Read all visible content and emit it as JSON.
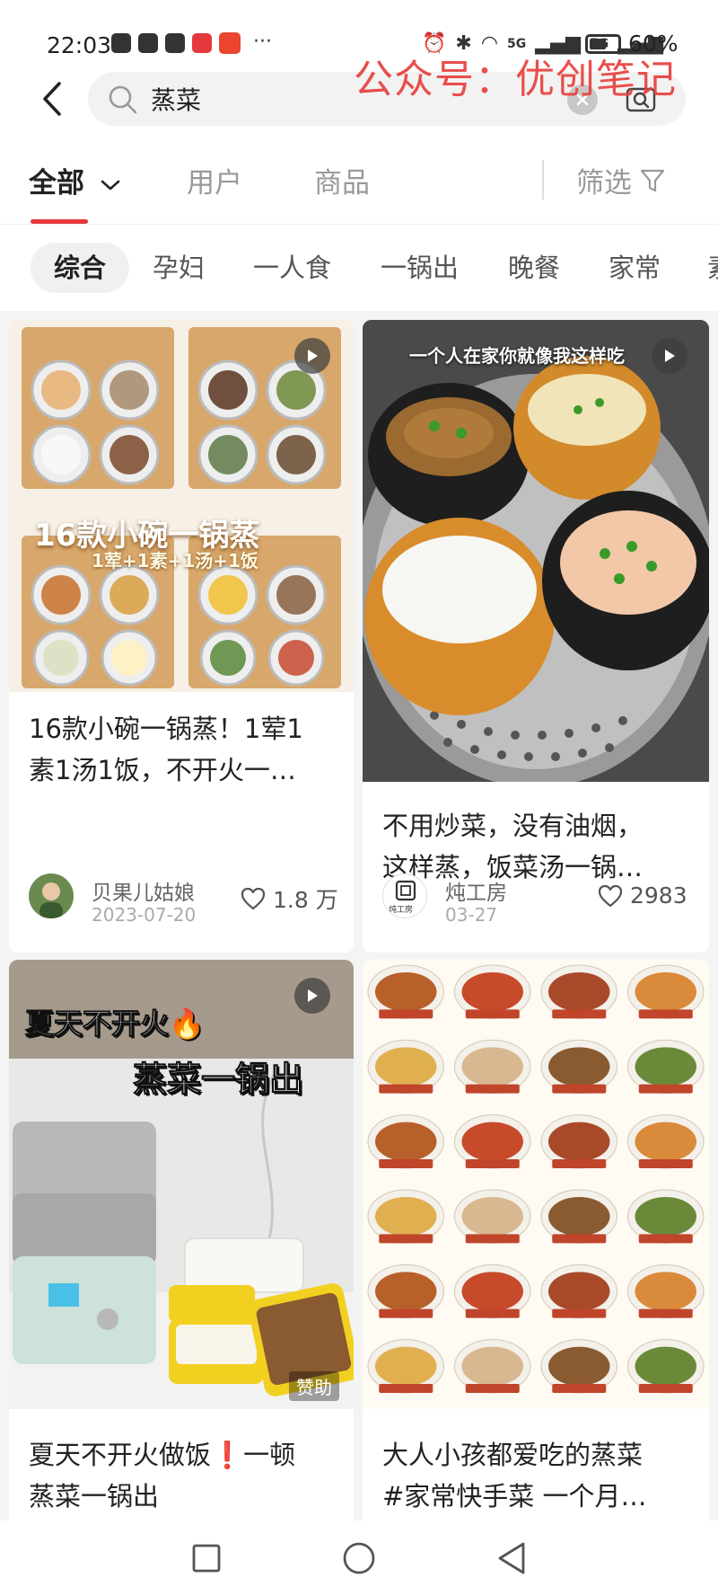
{
  "status_bar": {
    "time": "22:03",
    "battery": "60%",
    "signal_label_1": "5G",
    "signal_label_2": "5G"
  },
  "watermark": "公众号：优创笔记",
  "search": {
    "query": "蒸菜"
  },
  "tabs": [
    {
      "label": "全部"
    },
    {
      "label": "用户"
    },
    {
      "label": "商品"
    }
  ],
  "filter_label": "筛选",
  "chips": [
    {
      "label": "综合"
    },
    {
      "label": "孕妇"
    },
    {
      "label": "一人食"
    },
    {
      "label": "一锅出"
    },
    {
      "label": "晚餐"
    },
    {
      "label": "家常"
    },
    {
      "label": "素"
    }
  ],
  "cards": [
    {
      "title_line1": "16款小碗一锅蒸！1荤1",
      "title_line2": "素1汤1饭，不开火一…",
      "author": "贝果儿姑娘",
      "date": "2023-07-20",
      "likes": "1.8 万",
      "overlay_line1": "16款小碗一锅蒸",
      "overlay_line2": "1荤+1素+1汤+1饭"
    },
    {
      "title_line1": "不用炒菜，没有油烟，",
      "title_line2": "这样蒸，饭菜汤一锅…",
      "author": "炖工房",
      "date": "03-27",
      "likes": "2983",
      "overlay_line1": "一个人在家你就像我这样吃",
      "avatar_text": "炖工房"
    },
    {
      "title_line1": "夏天不开火做饭❗一顿",
      "title_line2": "蒸菜一锅出",
      "overlay_line1": "夏天不开火🔥",
      "overlay_line2": "蒸菜一锅出",
      "ad_label": "赞助"
    },
    {
      "title_line1": "大人小孩都爱吃的蒸菜",
      "title_line2": "#家常快手菜  一个月…"
    }
  ],
  "colors": {
    "accent": "#e4393c",
    "watermark": "#e8413d",
    "page_bg": "#f4f4f4"
  }
}
